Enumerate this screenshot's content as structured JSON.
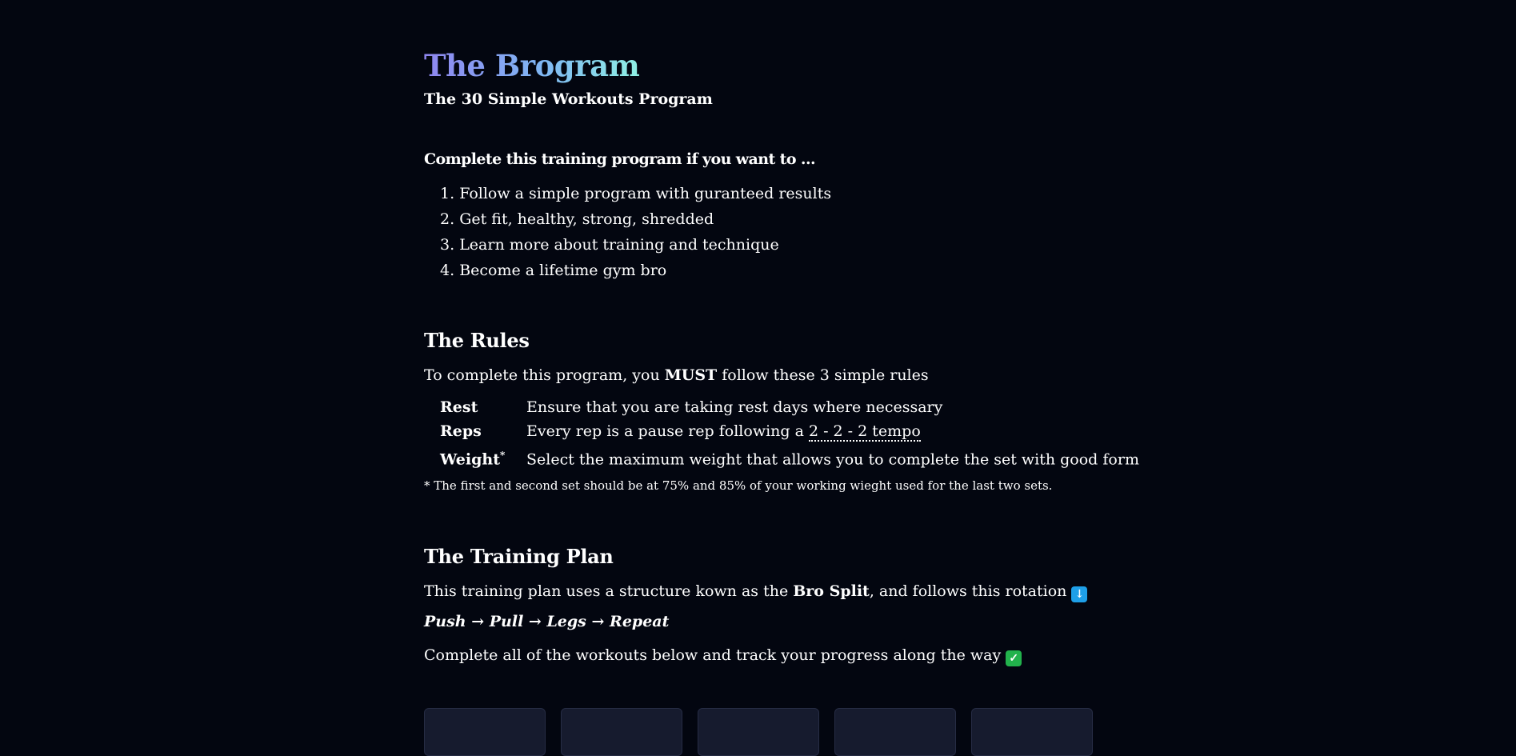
{
  "header": {
    "title": "The Brogram",
    "subtitle": "The 30 Simple Workouts Program"
  },
  "intro": {
    "heading": "Complete this training program if you want to ...",
    "goals": [
      {
        "num": "1.",
        "text": "Follow a simple program with guranteed results"
      },
      {
        "num": "2.",
        "text": "Get fit, healthy, strong, shredded"
      },
      {
        "num": "3.",
        "text": "Learn more about training and technique"
      },
      {
        "num": "4.",
        "text": "Become a lifetime gym bro"
      }
    ]
  },
  "rules": {
    "heading": "The Rules",
    "intro_before": "To complete this program, you ",
    "intro_bold": "MUST",
    "intro_after": " follow these 3 simple rules",
    "items": [
      {
        "name": "Rest",
        "description": "Ensure that you are taking rest days where necessary"
      },
      {
        "name": "Reps",
        "description_before": "Every rep is a pause rep following a ",
        "tempo": "2 - 2 - 2 tempo"
      },
      {
        "name": "Weight",
        "marker": "*",
        "description": "Select the maximum weight that allows you to complete the set with good form"
      }
    ],
    "footnote": "* The first and second set should be at 75% and 85% of your working wieght used for the last two sets."
  },
  "plan": {
    "heading": "The Training Plan",
    "desc_before": "This training plan uses a structure kown as the ",
    "desc_bold": "Bro Split",
    "desc_after": ", and follows this rotation ",
    "rotation_icon": "down-arrow-emoji",
    "rotation": "Push → Pull → Legs → Repeat",
    "track_text": "Complete all of the workouts below and track your progress along the way ",
    "track_icon": "check-mark-emoji"
  },
  "colors": {
    "background": "#030610",
    "title_gradient_start": "#8f86f0",
    "title_gradient_end": "#8ff0e4",
    "card_background": "#161b2e",
    "down_emoji": "#1e9fe8",
    "check_emoji": "#22b24c"
  }
}
